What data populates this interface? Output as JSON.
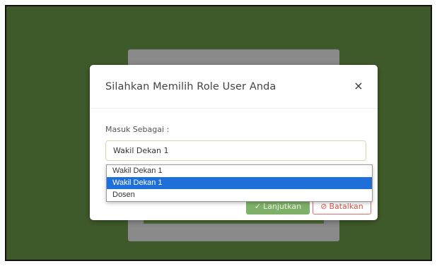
{
  "modal": {
    "title": "Silahkan Memilih Role User Anda",
    "close_symbol": "×",
    "field_label": "Masuk Sebagai :",
    "select_value": "Wakil Dekan 1",
    "options": [
      "Wakil Dekan 1",
      "Wakil Dekan 1",
      "Dosen"
    ],
    "selected_index": 1,
    "buttons": {
      "continue_label": "Lanjutkan",
      "continue_icon": "check-circle-icon",
      "cancel_label": "Batalkan",
      "cancel_icon": "x-circle-icon"
    }
  },
  "colors": {
    "page_background": "#3f5a2a",
    "continue_button": "#7fb069",
    "cancel_button": "#d9534f",
    "highlight": "#1e6fd9"
  }
}
